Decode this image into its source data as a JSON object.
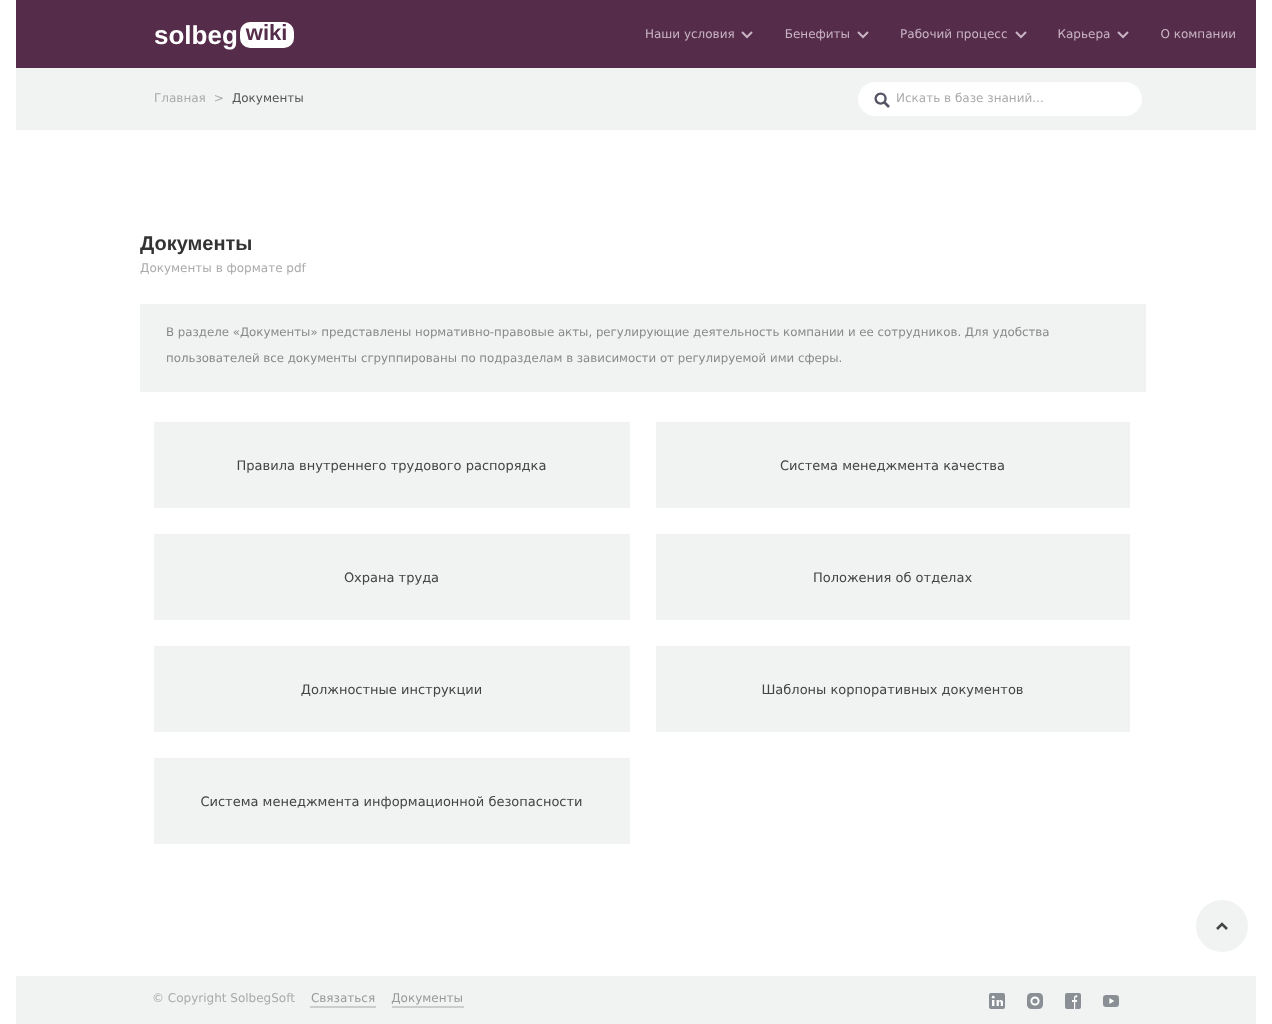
{
  "header": {
    "logo": {
      "text": "solbeg",
      "badge": "wiki"
    },
    "nav": [
      {
        "label": "Наши условия",
        "dropdown": true
      },
      {
        "label": "Бенефиты",
        "dropdown": true
      },
      {
        "label": "Рабочий процесс",
        "dropdown": true
      },
      {
        "label": "Карьера",
        "dropdown": true
      },
      {
        "label": "О компании",
        "dropdown": false
      }
    ]
  },
  "breadcrumb_separator": ">",
  "breadcrumbs": [
    {
      "label": "Главная",
      "current": false
    },
    {
      "label": "Документы",
      "current": true
    }
  ],
  "search": {
    "placeholder": "Искать в базе знаний..."
  },
  "page": {
    "title": "Документы",
    "subtitle": "Документы в формате pdf",
    "intro": "В разделе «Документы» представлены нормативно-правовые акты, регулирующие деятельность компании и ее сотрудников. Для удобства пользователей все документы сгруппированы по подразделам в зависимости от регулируемой ими сферы."
  },
  "categories": [
    "Правила внутреннего трудового распорядка",
    "Система менеджмента качества",
    "Охрана труда",
    "Положения об отделах",
    "Должностные инструкции",
    "Шаблоны корпоративных документов",
    "Система менеджмента информационной безопасности"
  ],
  "footer": {
    "copyright": "© Copyright SolbegSoft",
    "links": [
      "Связаться",
      "Документы"
    ],
    "social": [
      {
        "kind": "linkedin"
      },
      {
        "kind": "instagram"
      },
      {
        "kind": "facebook"
      },
      {
        "kind": "youtube"
      }
    ]
  }
}
